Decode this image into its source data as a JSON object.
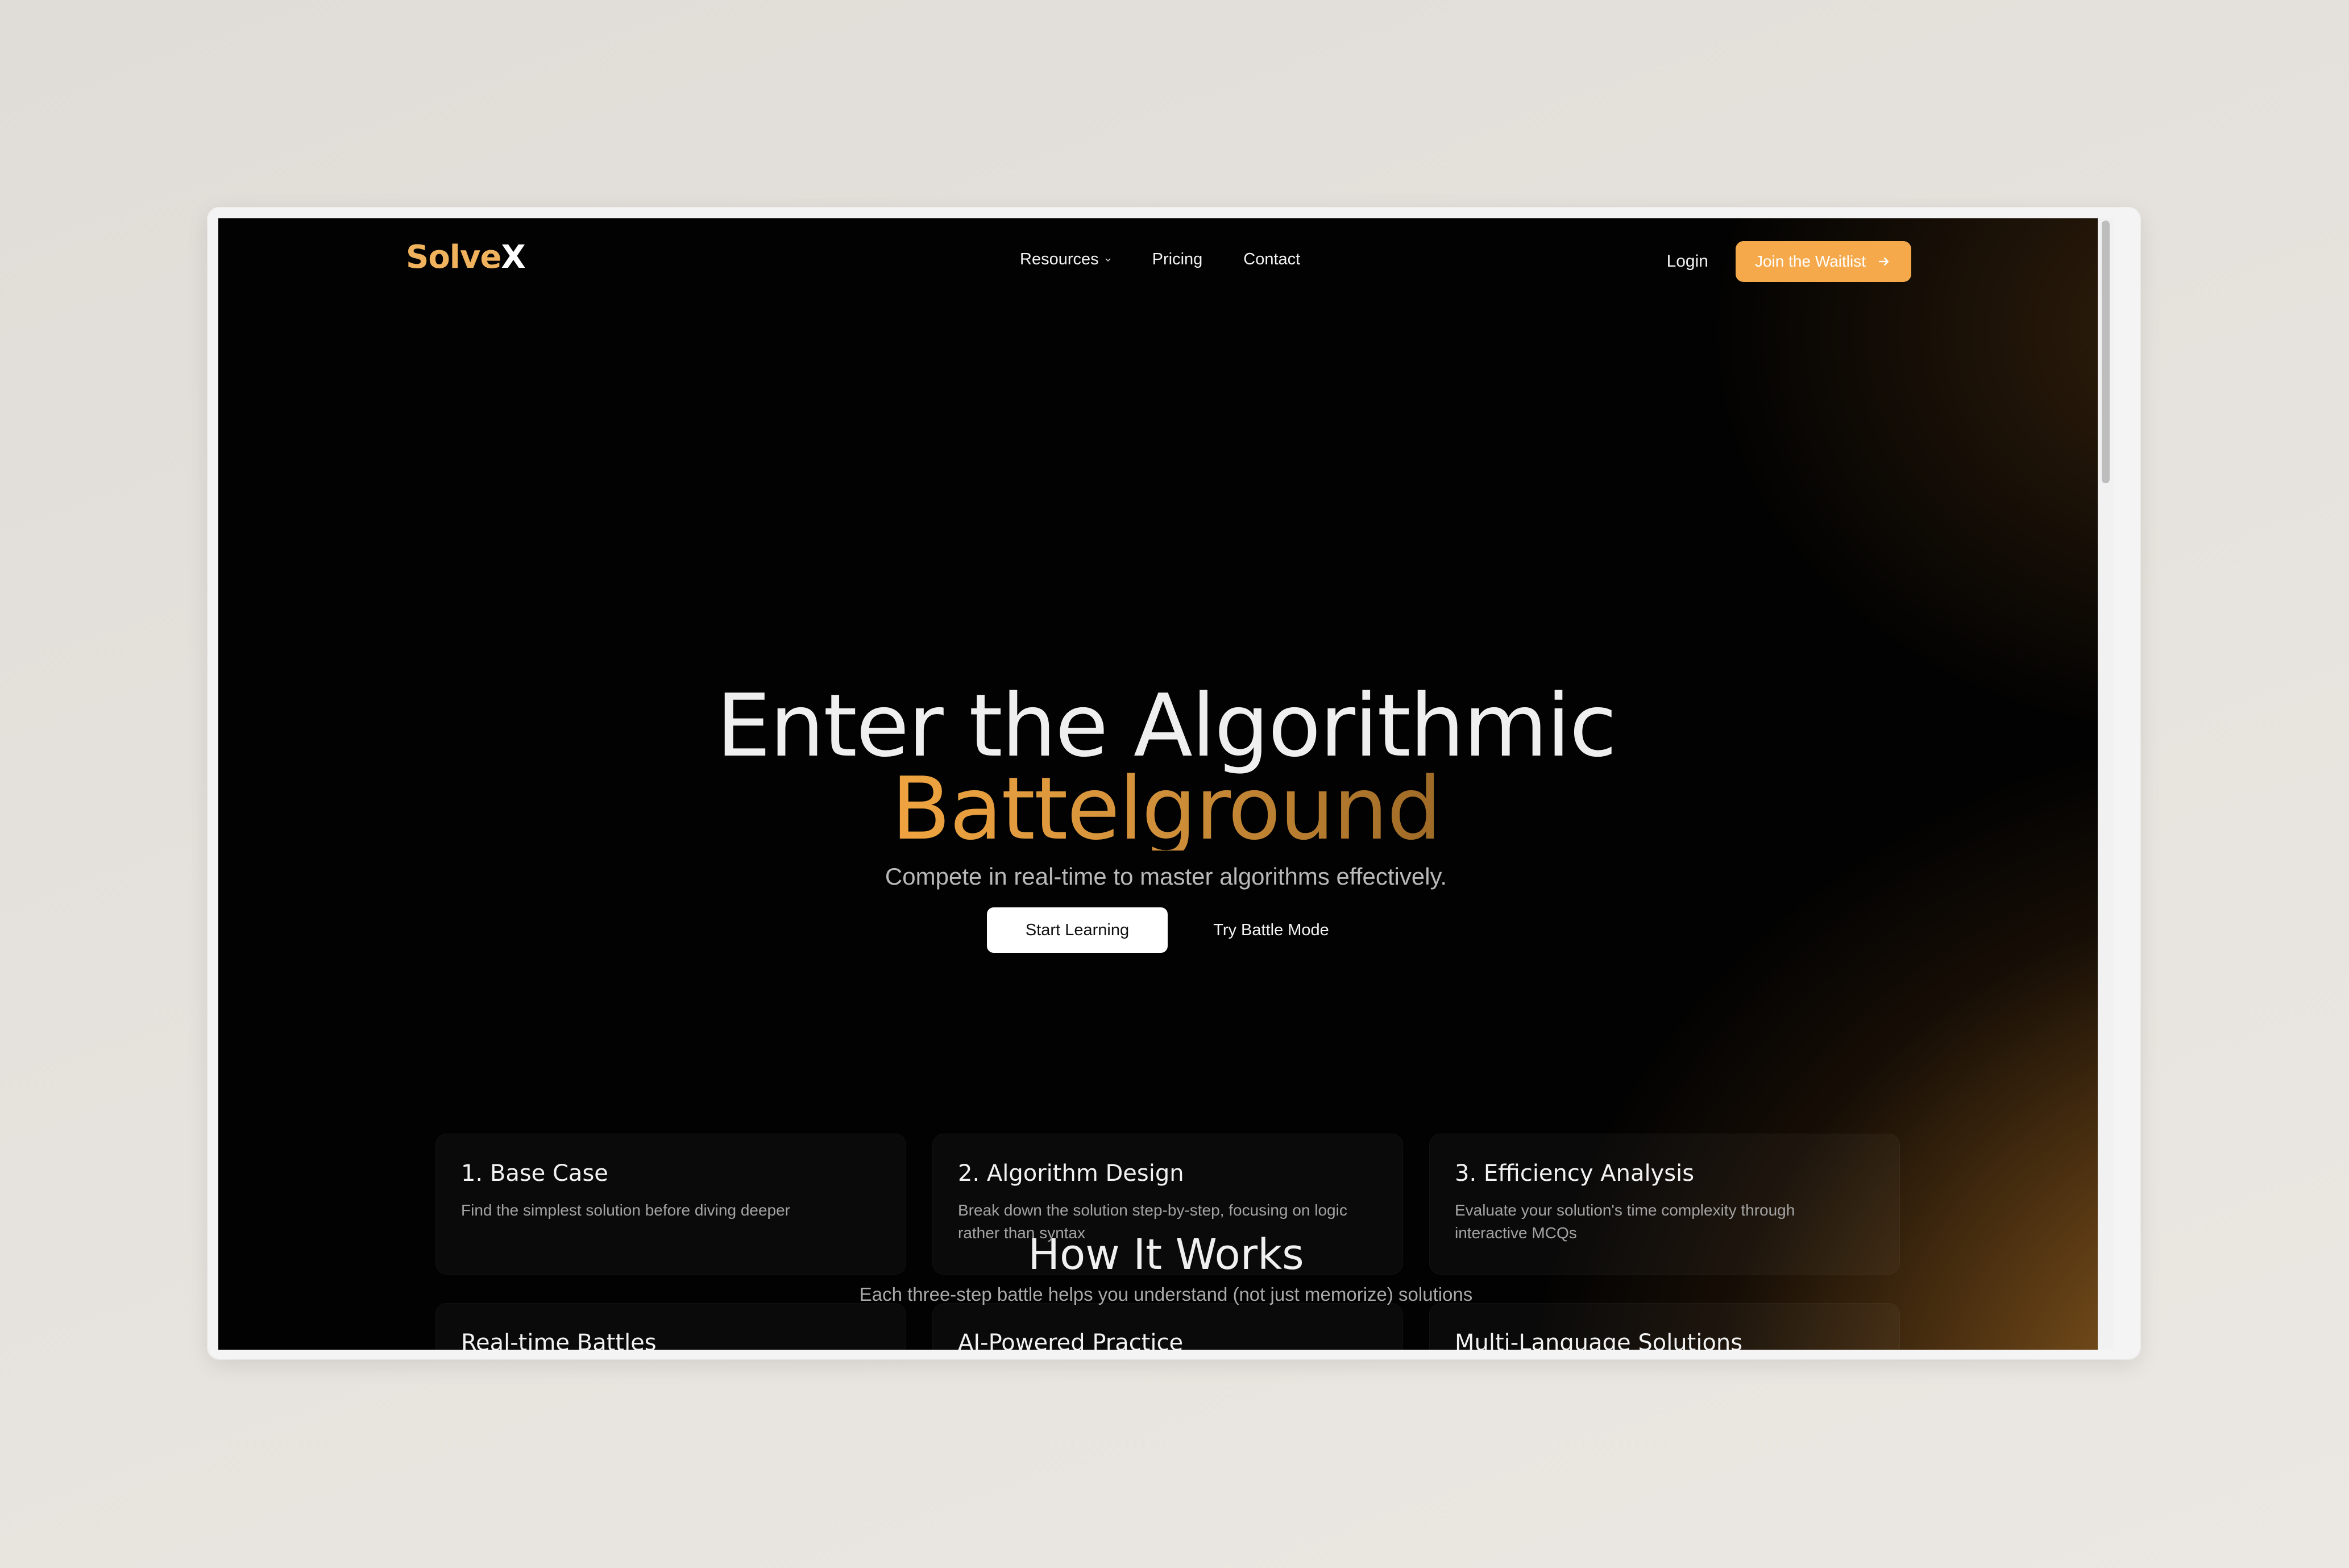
{
  "brand": {
    "name_part1": "Solve",
    "name_part2": "X",
    "accent_color": "#f5a94b"
  },
  "nav": {
    "links": [
      {
        "label": "Resources",
        "has_dropdown": true
      },
      {
        "label": "Pricing"
      },
      {
        "label": "Contact"
      }
    ],
    "login_label": "Login",
    "cta_label": "Join the Waitlist"
  },
  "hero": {
    "title_line1": "Enter the Algorithmic",
    "title_line2": "Battelground",
    "subtitle": "Compete in real-time to master algorithms effectively.",
    "primary_cta": "Start Learning",
    "secondary_cta": "Try Battle Mode"
  },
  "how_it_works": {
    "title": "How It Works",
    "subtitle": "Each three-step battle helps you understand (not just memorize) solutions",
    "steps": [
      {
        "title": "1. Base Case",
        "description": "Find the simplest solution before diving deeper"
      },
      {
        "title": "2. Algorithm Design",
        "description": "Break down the solution step-by-step, focusing on logic rather than syntax"
      },
      {
        "title": "3. Efficiency Analysis",
        "description": "Evaluate your solution's time complexity through interactive MCQs"
      }
    ],
    "features": [
      {
        "title": "Real-time Battles"
      },
      {
        "title": "AI-Powered Practice"
      },
      {
        "title": "Multi-Language Solutions"
      }
    ]
  }
}
